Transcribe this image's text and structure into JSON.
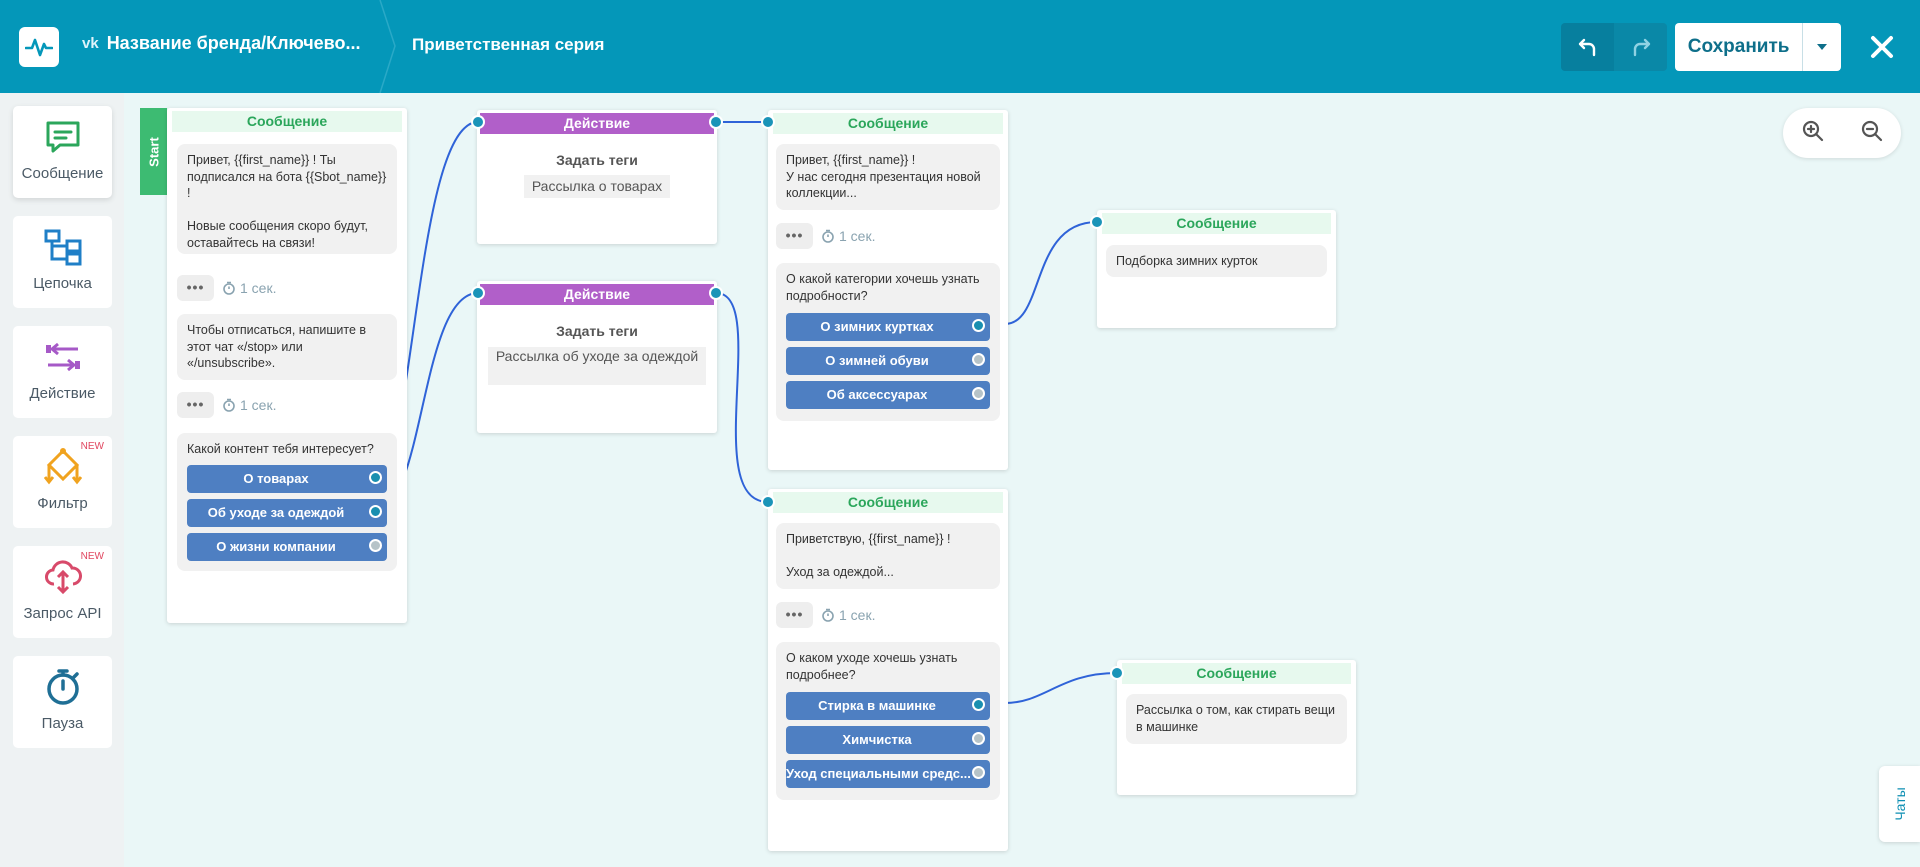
{
  "header": {
    "brand_icon": "vk",
    "brand_name": "Название бренда/Ключево...",
    "flow_title": "Приветственная серия",
    "save_label": "Сохранить"
  },
  "sidebar": {
    "items": [
      {
        "label": "Сообщение",
        "icon": "message-icon",
        "color": "#2ba65b"
      },
      {
        "label": "Цепочка",
        "icon": "chain-icon",
        "color": "#1f7fc7"
      },
      {
        "label": "Действие",
        "icon": "action-icon",
        "color": "#a659c7"
      },
      {
        "label": "Фильтр",
        "icon": "filter-icon",
        "color": "#f0a31f",
        "badge": "NEW"
      },
      {
        "label": "Запрос API",
        "icon": "api-cloud-icon",
        "color": "#d84a6a",
        "badge": "NEW"
      },
      {
        "label": "Пауза",
        "icon": "stopwatch-icon",
        "color": "#1f6f95"
      }
    ]
  },
  "canvas": {
    "start_label": "Start",
    "node1": {
      "header": "Сообщение",
      "bubble1": "Привет,  {{first_name}} ! Ты подписался на бота {{Sbot_name}} !\n\nНовые сообщения скоро будут, оставайтесь на связи!",
      "delay1": "1 сек.",
      "bubble2": "Чтобы отписаться, напишите в этот чат «/stop» или «/unsubscribe».",
      "delay2": "1 сек.",
      "question": "Какой контент тебя интересует?",
      "buttons": [
        "О товарах",
        "Об уходе за одеждой",
        "О жизни компании"
      ]
    },
    "action1": {
      "header": "Действие",
      "title": "Задать теги",
      "tag": "Рассылка о товарах"
    },
    "action2": {
      "header": "Действие",
      "title": "Задать теги",
      "tag": "Рассылка об уходе за одеждой"
    },
    "node2": {
      "header": "Сообщение",
      "bubble1": "Привет,  {{first_name}} !\nУ нас сегодня презентация новой коллекции...",
      "delay1": "1 сек.",
      "question": "О какой категории хочешь узнать подробности?",
      "buttons": [
        "О зимних куртках",
        "О зимней обуви",
        "Об аксессуарах"
      ]
    },
    "node3": {
      "header": "Сообщение",
      "bubble": "Подборка зимних курток"
    },
    "node4": {
      "header": "Сообщение",
      "bubble1": "Приветствую,  {{first_name}} !\n\nУход за одеждой...",
      "delay1": "1 сек.",
      "question": "О каком уходе хочешь узнать подробнее?",
      "buttons": [
        "Стирка в машинке",
        "Химчистка",
        "Уход специальными средс..."
      ]
    },
    "node5": {
      "header": "Сообщение",
      "bubble": "Рассылка о том, как стирать вещи в машинке"
    }
  },
  "chats_tab": "Чаты",
  "colors": {
    "topbar": "#0497b9",
    "canvas": "#eaf7f7",
    "message_header": "#2ba65b",
    "action_header": "#b15fc9",
    "quick_reply": "#4e7fc2",
    "wire": "#2f63d8"
  }
}
